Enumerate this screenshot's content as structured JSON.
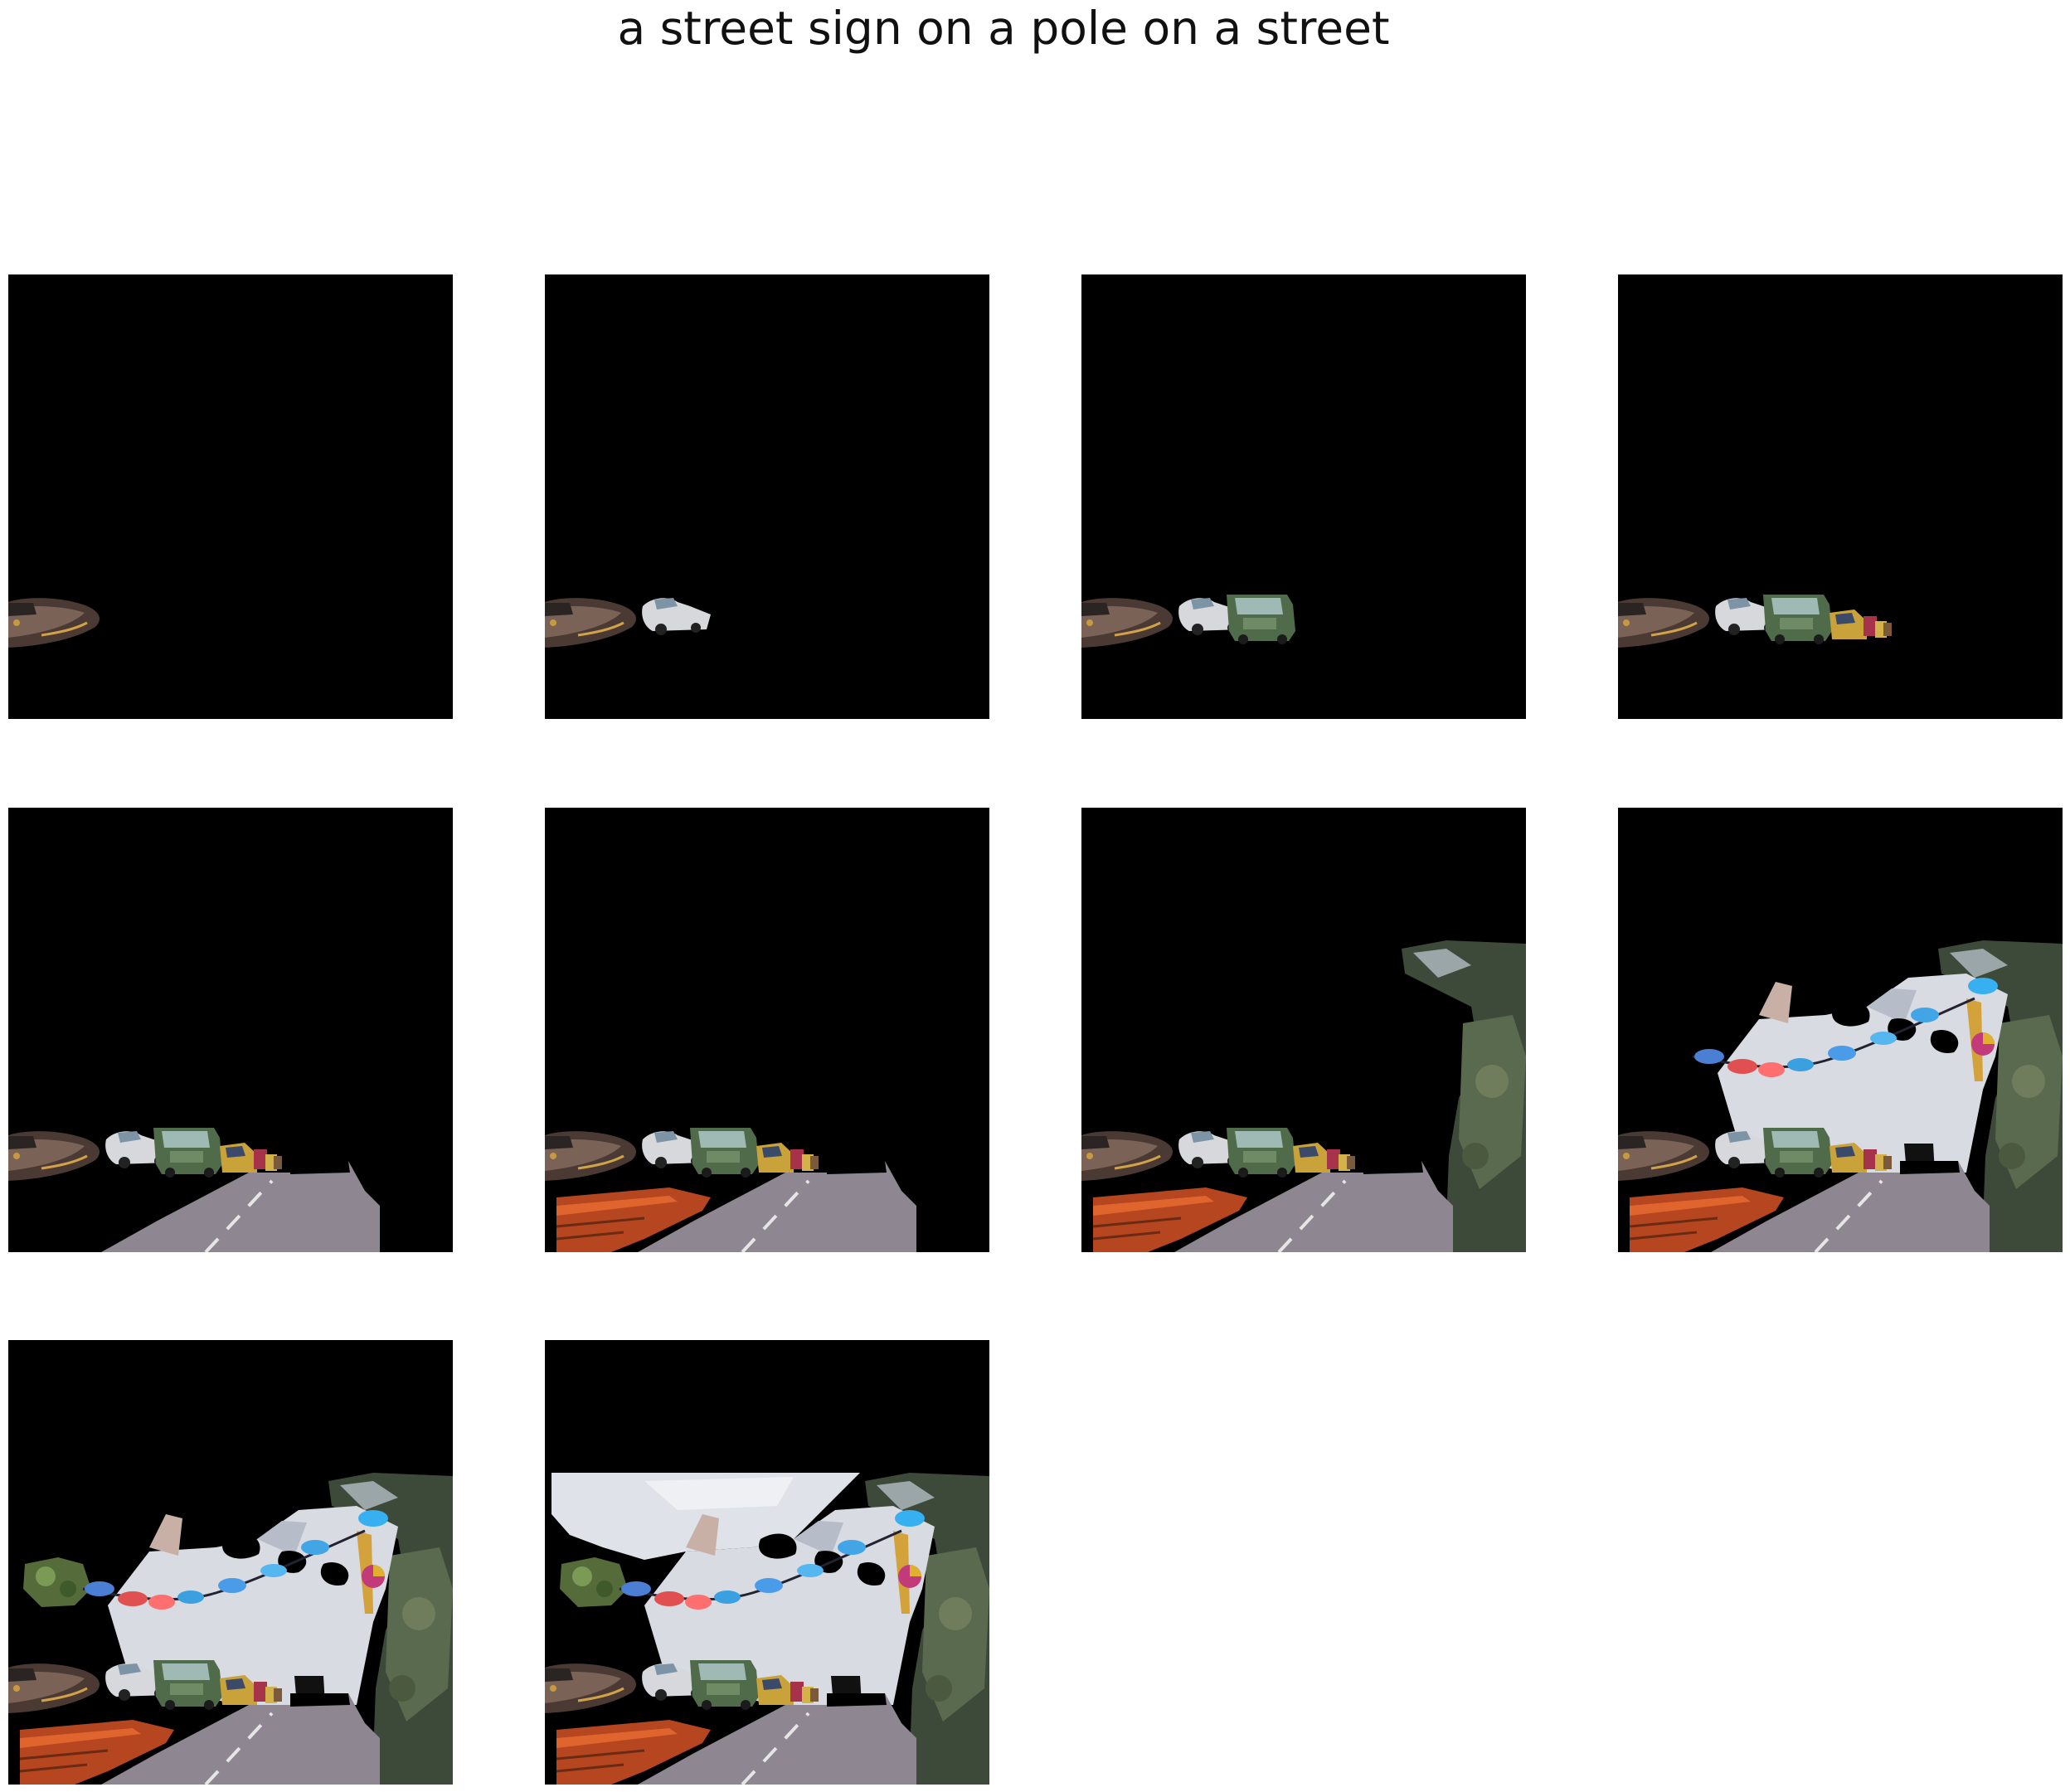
{
  "figure": {
    "title": "a street sign on a pole on a street",
    "background": "#ffffff",
    "panel_background": "#000000",
    "panel_count": 10,
    "panels": [
      {
        "id": 1,
        "visible_regions": [
          "car-left"
        ]
      },
      {
        "id": 2,
        "visible_regions": [
          "car-left",
          "white-car"
        ]
      },
      {
        "id": 3,
        "visible_regions": [
          "car-left",
          "white-car",
          "green-truck"
        ]
      },
      {
        "id": 4,
        "visible_regions": [
          "car-left",
          "white-car",
          "green-truck",
          "yellow-vehicles"
        ]
      },
      {
        "id": 5,
        "visible_regions": [
          "car-left",
          "white-car",
          "green-truck",
          "yellow-vehicles",
          "road"
        ]
      },
      {
        "id": 6,
        "visible_regions": [
          "car-left",
          "white-car",
          "green-truck",
          "yellow-vehicles",
          "road",
          "red-wall"
        ]
      },
      {
        "id": 7,
        "visible_regions": [
          "car-left",
          "white-car",
          "green-truck",
          "yellow-vehicles",
          "road",
          "red-wall",
          "tree-right"
        ]
      },
      {
        "id": 8,
        "visible_regions": [
          "car-left",
          "white-car",
          "green-truck",
          "yellow-vehicles",
          "road",
          "red-wall",
          "tree-right",
          "building",
          "banners"
        ]
      },
      {
        "id": 9,
        "visible_regions": [
          "car-left",
          "white-car",
          "green-truck",
          "yellow-vehicles",
          "road",
          "red-wall",
          "tree-right",
          "building",
          "banners",
          "tree-left"
        ]
      },
      {
        "id": 10,
        "visible_regions": [
          "car-left",
          "white-car",
          "green-truck",
          "yellow-vehicles",
          "road",
          "red-wall",
          "tree-right",
          "building",
          "banners",
          "tree-left",
          "sky"
        ]
      }
    ]
  }
}
